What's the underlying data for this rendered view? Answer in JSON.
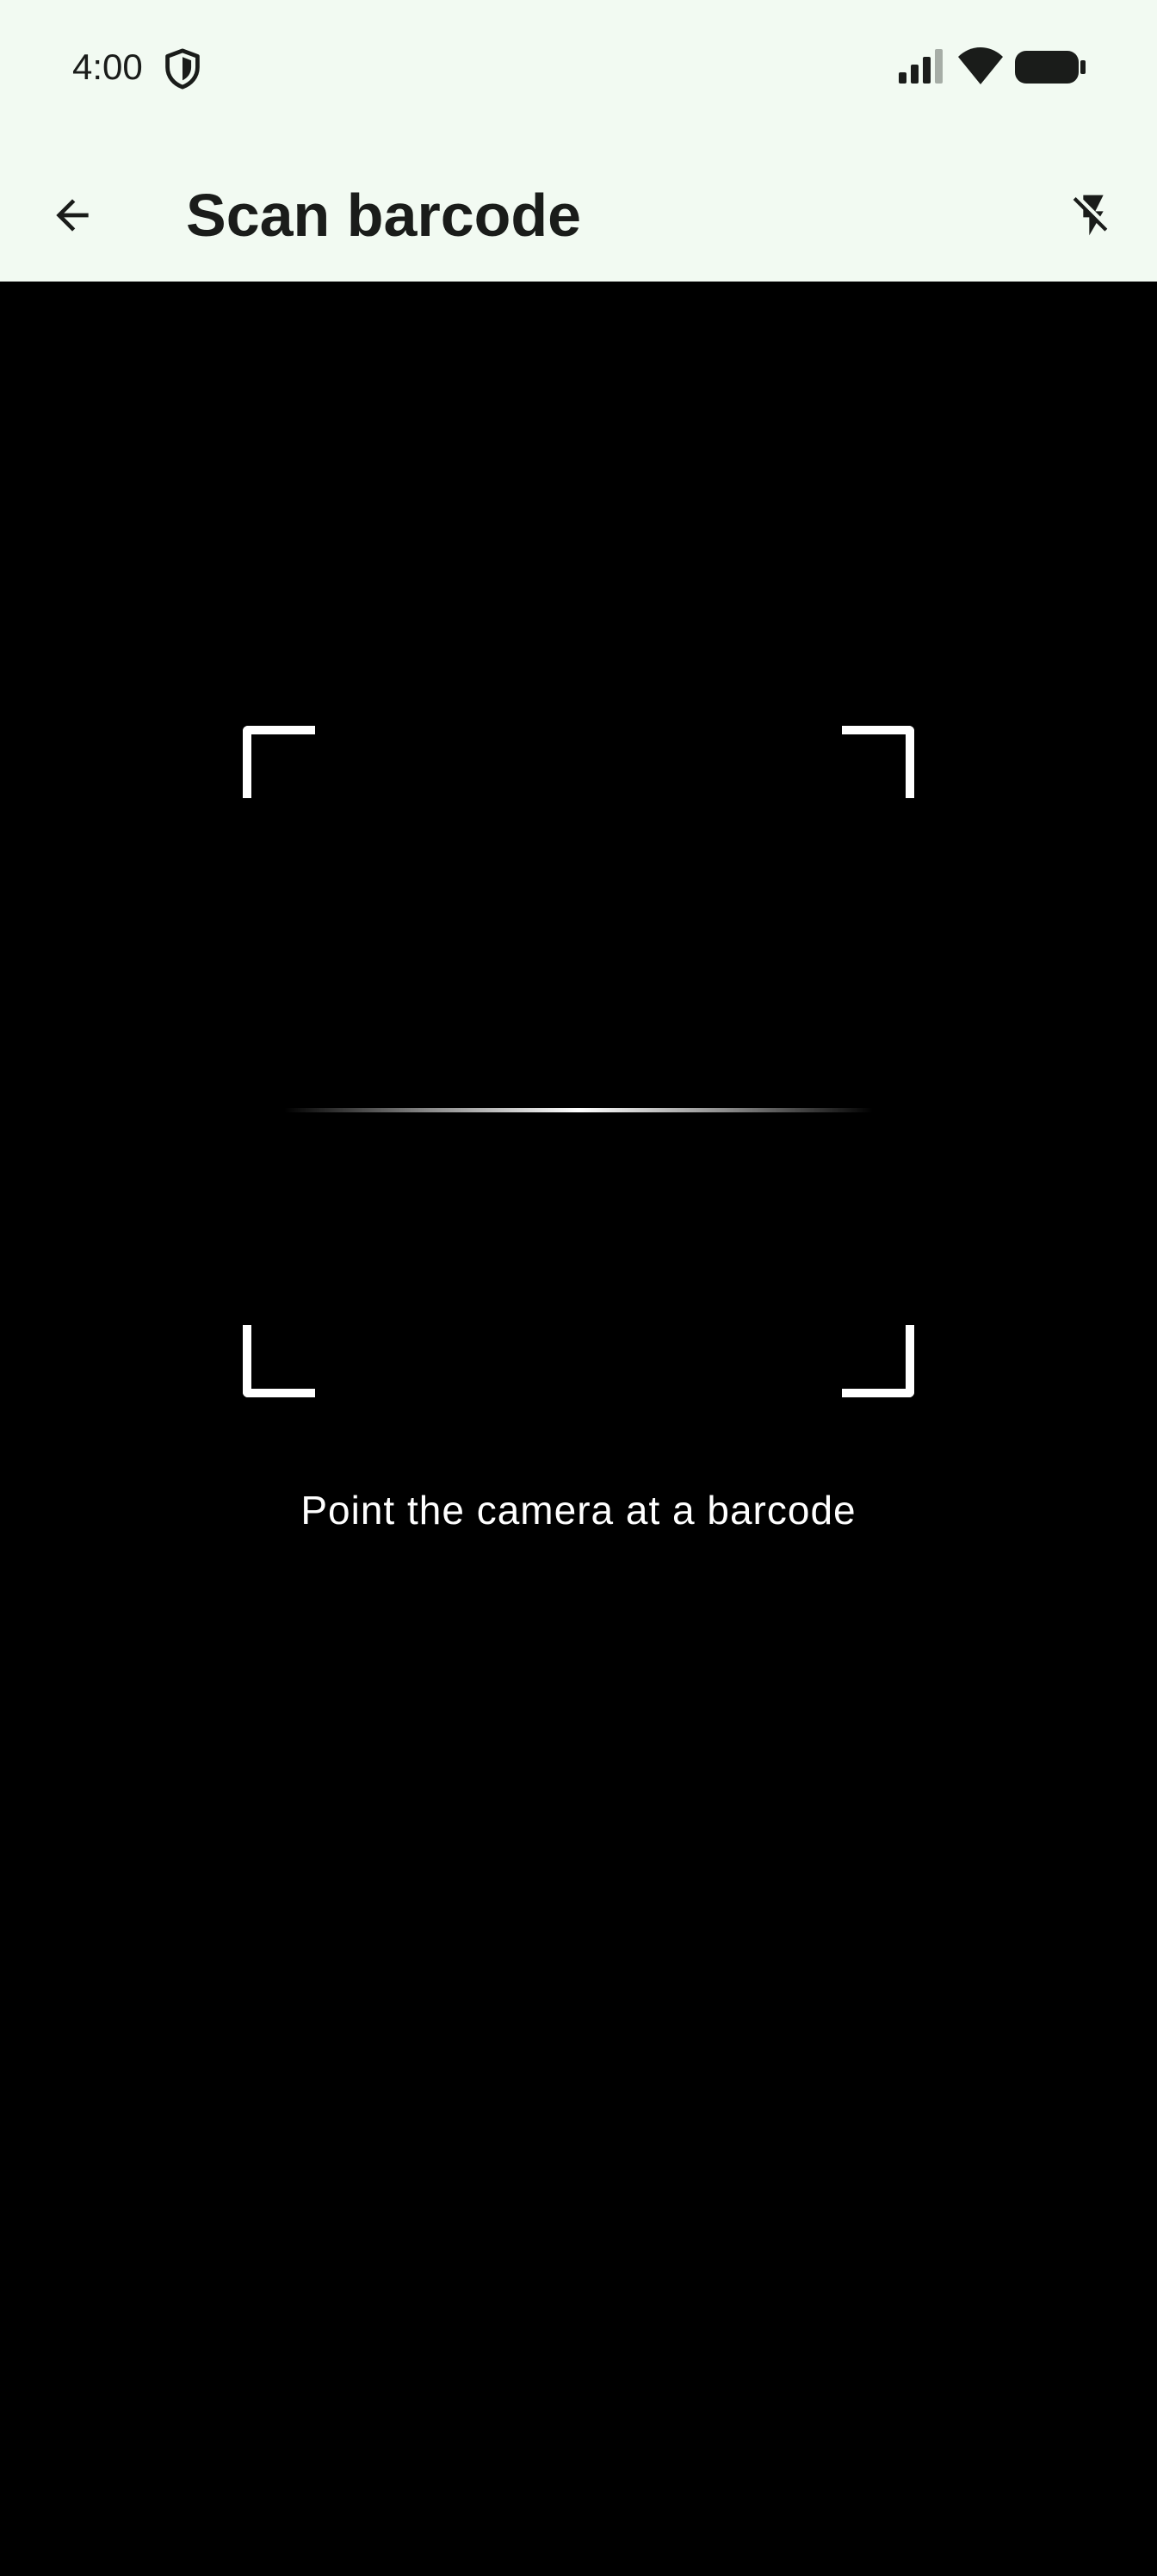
{
  "status_bar": {
    "time": "4:00",
    "icons": [
      "shield-icon",
      "cellular-signal-icon",
      "wifi-icon",
      "battery-icon"
    ]
  },
  "app_bar": {
    "back_icon": "arrow-back-icon",
    "title": "Scan barcode",
    "flash_icon": "flash-off-icon",
    "background_color": "#f2faf2"
  },
  "scanner": {
    "hint": "Point the camera at a barcode",
    "background_color": "#000000",
    "frame_color": "#ffffff"
  }
}
